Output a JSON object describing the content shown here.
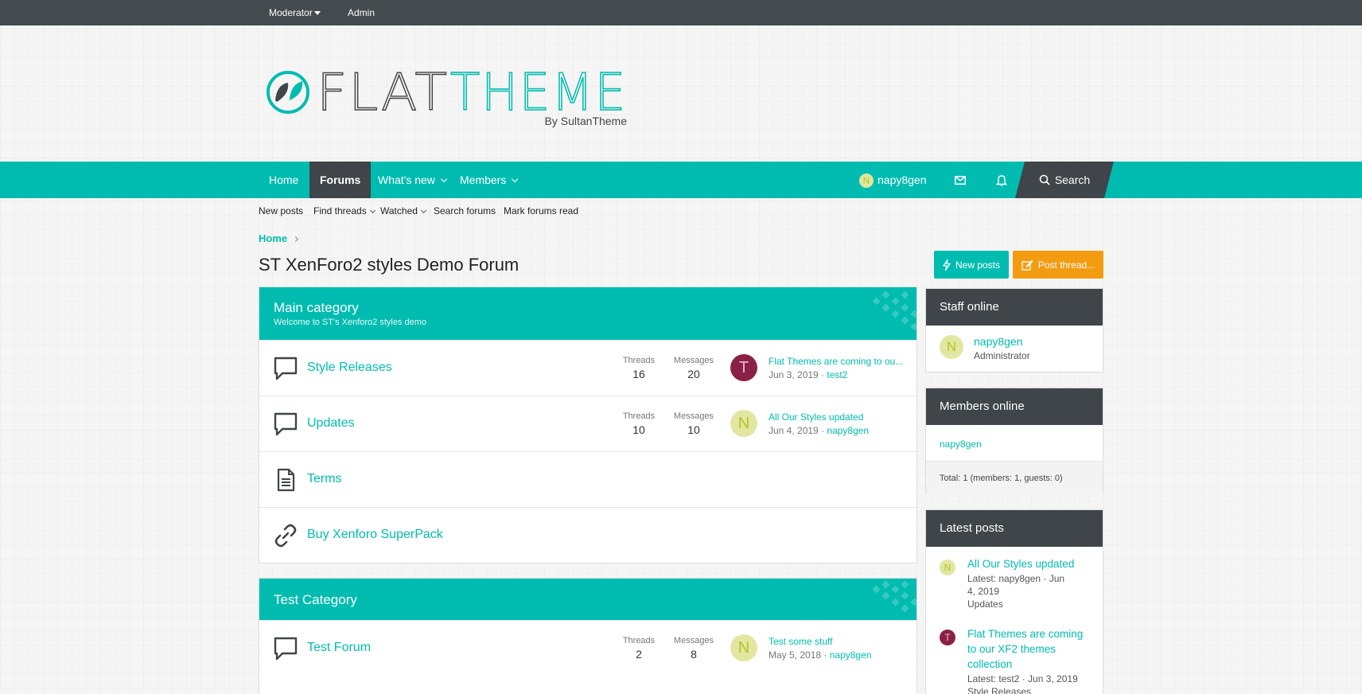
{
  "staffbar": {
    "moderator": "Moderator",
    "admin": "Admin"
  },
  "logo": {
    "flat": "FLAT",
    "theme": "THEME",
    "byline": "By SultanTheme"
  },
  "nav": {
    "home": "Home",
    "forums": "Forums",
    "whats_new": "What's new",
    "members": "Members",
    "user": "napy8gen",
    "user_initial": "N",
    "search": "Search"
  },
  "subnav": {
    "new_posts": "New posts",
    "find_threads": "Find threads",
    "watched": "Watched",
    "search_forums": "Search forums",
    "mark_read": "Mark forums read"
  },
  "breadcrumb": {
    "home": "Home"
  },
  "page": {
    "title": "ST XenForo2 styles Demo Forum"
  },
  "actions": {
    "new_posts": "New posts",
    "post_thread": "Post thread..."
  },
  "main_category": {
    "title": "Main category",
    "description": "Welcome to ST's Xenforo2 styles demo",
    "nodes": [
      {
        "title": "Style Releases",
        "threads_label": "Threads",
        "threads": "16",
        "messages_label": "Messages",
        "messages": "20",
        "avatar": "T",
        "last_title": "Flat Themes are coming to ou...",
        "last_date": "Jun 3, 2019",
        "last_user": "test2"
      },
      {
        "title": "Updates",
        "threads_label": "Threads",
        "threads": "10",
        "messages_label": "Messages",
        "messages": "10",
        "avatar": "N",
        "last_title": "All Our Styles updated",
        "last_date": "Jun 4, 2019",
        "last_user": "napy8gen"
      },
      {
        "title": "Terms"
      },
      {
        "title": "Buy Xenforo SuperPack"
      }
    ]
  },
  "test_category": {
    "title": "Test Category",
    "nodes": [
      {
        "title": "Test Forum",
        "threads_label": "Threads",
        "threads": "2",
        "messages_label": "Messages",
        "messages": "8",
        "avatar": "N",
        "last_title": "Test some stuff",
        "last_date": "May 5, 2018",
        "last_user": "napy8gen"
      }
    ]
  },
  "staff_online": {
    "title": "Staff online",
    "name": "napy8gen",
    "role": "Administrator",
    "initial": "N"
  },
  "members_online": {
    "title": "Members online",
    "member": "napy8gen",
    "total": "Total: 1 (members: 1, guests: 0)"
  },
  "latest_posts": {
    "title": "Latest posts",
    "items": [
      {
        "initial": "N",
        "title": "All Our Styles updated",
        "meta": "Latest: napy8gen · Jun 4, 2019",
        "forum": "Updates"
      },
      {
        "initial": "T",
        "title": "Flat Themes are coming to our XF2 themes collection",
        "meta": "Latest: test2 · Jun 3, 2019",
        "forum": "Style Releases"
      }
    ]
  },
  "colors": {
    "accent": "#00bcb0",
    "dark": "#3f4549",
    "staffbar": "#444b4f",
    "orange": "#f39c12"
  }
}
